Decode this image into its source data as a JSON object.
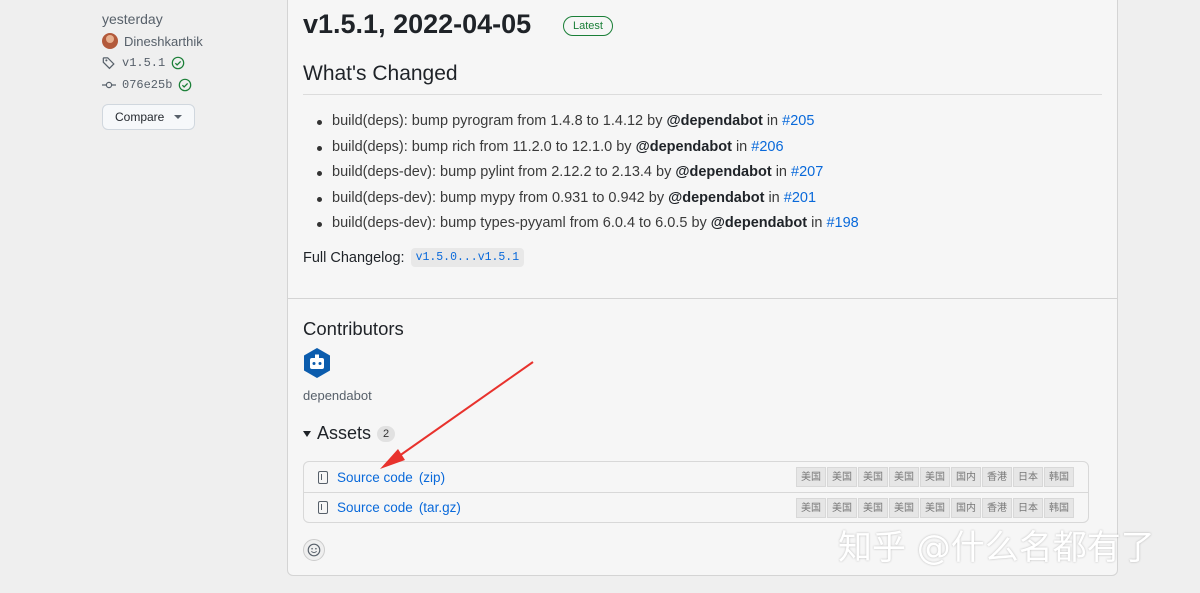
{
  "sidebar": {
    "time": "yesterday",
    "author": "Dineshkarthik",
    "tag": "v1.5.1",
    "commit": "076e25b",
    "compare_label": "Compare"
  },
  "release": {
    "title": "v1.5.1, 2022-04-05",
    "badge": "Latest",
    "whats_changed": "What's Changed",
    "changes": [
      {
        "prefix": "build(deps): bump pyrogram from 1.4.8 to 1.4.12 by",
        "author": "@dependabot",
        "mid": "in",
        "pr": "#205"
      },
      {
        "prefix": "build(deps): bump rich from 11.2.0 to 12.1.0 by",
        "author": "@dependabot",
        "mid": "in",
        "pr": "#206"
      },
      {
        "prefix": "build(deps-dev): bump pylint from 2.12.2 to 2.13.4 by",
        "author": "@dependabot",
        "mid": "in",
        "pr": "#207"
      },
      {
        "prefix": "build(deps-dev): bump mypy from 0.931 to 0.942 by",
        "author": "@dependabot",
        "mid": "in",
        "pr": "#201"
      },
      {
        "prefix": "build(deps-dev): bump types-pyyaml from 6.0.4 to 6.0.5 by",
        "author": "@dependabot",
        "mid": "in",
        "pr": "#198"
      }
    ],
    "full_changelog_label": "Full Changelog",
    "full_changelog_sep": ":",
    "full_changelog_link": "v1.5.0...v1.5.1",
    "contributors_title": "Contributors",
    "contributor_name": "dependabot",
    "assets_title": "Assets",
    "assets_count": "2",
    "assets": [
      {
        "name": "Source code",
        "ext": "(zip)"
      },
      {
        "name": "Source code",
        "ext": "(tar.gz)"
      }
    ],
    "mirror_tags": [
      "美国",
      "美国",
      "美国",
      "美国",
      "美国",
      "国内",
      "香港",
      "日本",
      "韩国"
    ]
  },
  "watermark": "知乎 @什么名都有了",
  "colors": {
    "link": "#0969da",
    "success": "#1a7f37",
    "annotation_arrow": "#e8322d",
    "bot_avatar": "#0b5cad"
  }
}
